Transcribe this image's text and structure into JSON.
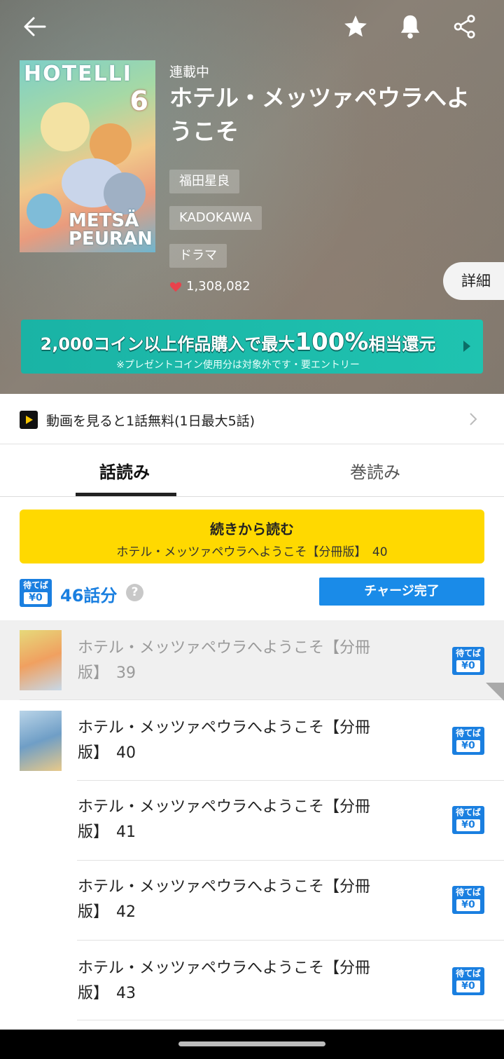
{
  "header": {
    "status": "連載中",
    "title": "ホテル・メッツァペウラへようこそ",
    "author": "福田星良",
    "publisher": "KADOKAWA",
    "genre": "ドラマ",
    "likes": "1,308,082",
    "detail_label": "詳細",
    "cover": {
      "title_text": "HOTELLI",
      "volume": "6",
      "subtitle": "METSÄ PEURAN"
    },
    "icons": [
      "back-arrow-icon",
      "star-icon",
      "bell-icon",
      "share-icon"
    ]
  },
  "banner": {
    "main_prefix": "2,000コイン以上作品購入で最大",
    "main_highlight": "100%",
    "main_suffix": "相当還元",
    "sub": "※プレゼントコイン使用分は対象外です・要エントリー"
  },
  "video": {
    "label": "動画を見ると1話無料(1日最大5話)"
  },
  "tabs": [
    {
      "label": "話読み",
      "active": true
    },
    {
      "label": "巻読み",
      "active": false
    }
  ],
  "continue": {
    "label": "続きから読む",
    "sub": "ホテル・メッツァペウラへようこそ【分冊版】　40"
  },
  "wait_badge": {
    "top": "待てば",
    "bottom": "¥0"
  },
  "count": {
    "text": "46話分",
    "help": "?",
    "charge_label": "チャージ完了"
  },
  "episodes": [
    {
      "title_line1": "ホテル・メッツァペウラへようこそ【分冊",
      "title_line2": "版】　39",
      "read": true
    },
    {
      "title_line1": "ホテル・メッツァペウラへようこそ【分冊",
      "title_line2": "版】　40",
      "read": false
    },
    {
      "title_line1": "ホテル・メッツァペウラへようこそ【分冊",
      "title_line2": "版】　41",
      "read": false
    },
    {
      "title_line1": "ホテル・メッツァペウラへようこそ【分冊",
      "title_line2": "版】　42",
      "read": false
    },
    {
      "title_line1": "ホテル・メッツァペウラへようこそ【分冊",
      "title_line2": "版】　43",
      "read": false
    }
  ],
  "colors": {
    "accent_blue": "#1a7fe0",
    "continue_yellow": "#ffd900",
    "banner_teal": "#1ab3a5",
    "heart_red": "#e8424c"
  }
}
